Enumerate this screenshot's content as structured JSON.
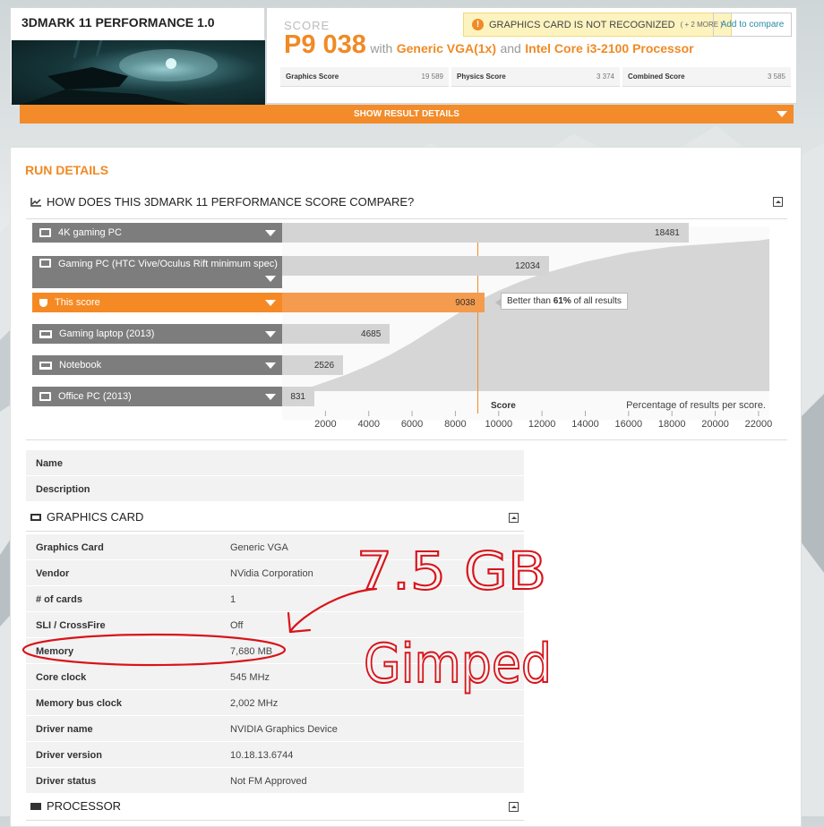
{
  "header": {
    "test_title": "3DMARK 11 PERFORMANCE 1.0",
    "score_label": "SCORE",
    "score_value": "P9 038",
    "with_text": "with",
    "gpu": "Generic VGA(1x)",
    "and_text": "and",
    "cpu": "Intel Core i3-2100 Processor",
    "warning": "GRAPHICS CARD IS NOT RECOGNIZED",
    "warning_more": "( + 2 MORE )",
    "add_compare": "Add to compare",
    "subscores": [
      {
        "name": "Graphics Score",
        "value": "19 589"
      },
      {
        "name": "Physics Score",
        "value": "3 374"
      },
      {
        "name": "Combined Score",
        "value": "3 585"
      }
    ],
    "show_details": "SHOW RESULT DETAILS"
  },
  "run_details": {
    "title": "RUN DETAILS",
    "compare_title": "HOW DOES THIS 3DMARK 11 PERFORMANCE SCORE COMPARE?",
    "rows": [
      {
        "label": "4K gaming PC",
        "value": "18481",
        "score": 18481
      },
      {
        "label": "Gaming PC (HTC Vive/Oculus Rift minimum spec)",
        "value": "12034",
        "score": 12034
      },
      {
        "label": "This score",
        "value": "9038",
        "score": 9038
      },
      {
        "label": "Gaming laptop (2013)",
        "value": "4685",
        "score": 4685
      },
      {
        "label": "Notebook",
        "value": "2526",
        "score": 2526
      },
      {
        "label": "Office PC (2013)",
        "value": "831",
        "score": 831
      }
    ],
    "better_prefix": "Better than ",
    "better_pct": "61%",
    "better_suffix": " of all results"
  },
  "chart_data": {
    "type": "area",
    "xlabel": "Score",
    "ylabel": "",
    "annotation": "Percentage of results per score.",
    "x_ticks": [
      "2000",
      "4000",
      "6000",
      "8000",
      "10000",
      "12000",
      "14000",
      "16000",
      "18000",
      "20000",
      "22000"
    ],
    "xlim": [
      0,
      22500
    ],
    "marker": 9038,
    "x": [
      1200,
      2000,
      3000,
      4000,
      5000,
      6000,
      7000,
      8000,
      9000,
      10000,
      11000,
      12000,
      13000,
      14000,
      15000,
      16000,
      17000,
      18000,
      19000,
      20000,
      21000,
      22000,
      22500
    ],
    "y": [
      0.02,
      0.06,
      0.11,
      0.17,
      0.24,
      0.32,
      0.41,
      0.5,
      0.59,
      0.66,
      0.72,
      0.77,
      0.81,
      0.85,
      0.88,
      0.91,
      0.93,
      0.95,
      0.96,
      0.97,
      0.98,
      0.99,
      1.0
    ],
    "colors": {
      "area": "#d6d6d6",
      "marker": "#f08a24"
    }
  },
  "system_info": {
    "rows": [
      {
        "key": "Name",
        "value": ""
      },
      {
        "key": "Description",
        "value": ""
      }
    ]
  },
  "graphics_card": {
    "title": "GRAPHICS CARD",
    "rows": [
      {
        "key": "Graphics Card",
        "value": "Generic VGA"
      },
      {
        "key": "Vendor",
        "value": "NVidia Corporation"
      },
      {
        "key": "# of cards",
        "value": "1"
      },
      {
        "key": "SLI / CrossFire",
        "value": "Off"
      },
      {
        "key": "Memory",
        "value": "7,680 MB"
      },
      {
        "key": "Core clock",
        "value": "545 MHz"
      },
      {
        "key": "Memory bus clock",
        "value": "2,002 MHz"
      },
      {
        "key": "Driver name",
        "value": "NVIDIA Graphics Device"
      },
      {
        "key": "Driver version",
        "value": "10.18.13.6744"
      },
      {
        "key": "Driver status",
        "value": "Not FM Approved"
      }
    ]
  },
  "processor": {
    "title": "PROCESSOR"
  },
  "annotation": {
    "line1": "7.5 GB",
    "line2": "Gimped",
    "color": "#d8141a"
  },
  "colors": {
    "accent": "#f08a24",
    "warning_bg": "#fdf3bf",
    "link": "#2a8aa6"
  }
}
